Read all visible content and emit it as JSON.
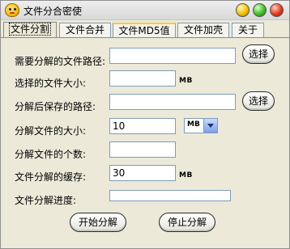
{
  "window": {
    "title": "文件分合密使"
  },
  "tabs": [
    "文件分割",
    "文件合并",
    "文件MD5值",
    "文件加壳",
    "关于"
  ],
  "form": {
    "source_path_label": "需要分解的文件路径:",
    "browse_button": "选择",
    "selected_size_label": "选择的文件大小:",
    "selected_size_unit": "MB",
    "output_path_label": "分解后保存的路径:",
    "browse_button_2": "选择",
    "split_size_label": "分解文件的大小:",
    "split_size_value": "10",
    "split_unit_value": "MB",
    "split_count_label": "分解文件的个数:",
    "cache_label": "文件分解的缓存:",
    "cache_value": "30",
    "cache_unit": "MB",
    "progress_label": "文件分解进度:",
    "progress_value": 0
  },
  "actions": {
    "start": "开始分解",
    "stop": "停止分解"
  }
}
